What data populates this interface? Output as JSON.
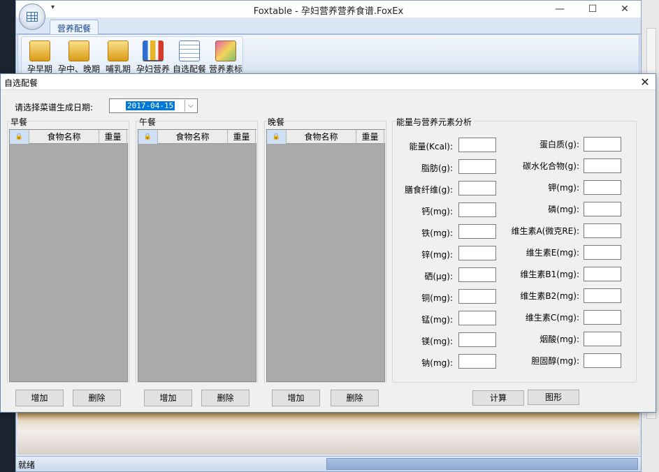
{
  "window": {
    "title": "Foxtable - 孕妇营养营养食谱.FoxEx",
    "qat_glyph": "▾",
    "min_glyph": "—",
    "max_glyph": "☐",
    "close_glyph": "✕"
  },
  "ribbon": {
    "active_tab": "营养配餐",
    "buttons": [
      {
        "label": "孕早期",
        "icon": "folder-stack-icon"
      },
      {
        "label": "孕中、晚期",
        "icon": "folder-stack-icon"
      },
      {
        "label": "哺乳期",
        "icon": "folder-stack-icon"
      },
      {
        "label": "孕妇营养",
        "icon": "bar-chart-icon"
      },
      {
        "label": "自选配餐",
        "icon": "table-star-icon"
      },
      {
        "label": "营养素标",
        "icon": "gift-star-icon"
      }
    ]
  },
  "status": {
    "text": "就绪"
  },
  "dialog": {
    "title": "自选配餐",
    "close_glyph": "✕",
    "date_label": "请选择菜谱生成日期:",
    "date_value": "2017-04-15",
    "dropdown_glyph": "⌵",
    "meals": [
      {
        "title": "早餐",
        "col_lock": "🔒",
        "col_name": "食物名称",
        "col_weight": "重量",
        "add": "增加",
        "delete": "删除"
      },
      {
        "title": "午餐",
        "col_lock": "🔒",
        "col_name": "食物名称",
        "col_weight": "重量",
        "add": "增加",
        "delete": "删除"
      },
      {
        "title": "晚餐",
        "col_lock": "🔒",
        "col_name": "食物名称",
        "col_weight": "重量",
        "add": "增加",
        "delete": "删除"
      }
    ],
    "nutrition": {
      "title": "能量与营养元素分析",
      "left": [
        "能量(Kcal):",
        "脂肪(g):",
        "膳食纤维(g):",
        "钙(mg):",
        "铁(mg):",
        "锌(mg):",
        "硒(μg):",
        "铜(mg):",
        "锰(mg):",
        "镁(mg):",
        "钠(mg):"
      ],
      "right": [
        "蛋白质(g):",
        "碳水化合物(g):",
        "钾(mg):",
        "磷(mg):",
        "维生素A(微克RE):",
        "维生素E(mg):",
        "维生素B1(mg):",
        "维生素B2(mg):",
        "维生素C(mg):",
        "烟酸(mg):",
        "胆固醇(mg):"
      ],
      "calc_button": "计算",
      "chart_button": "图形"
    }
  }
}
